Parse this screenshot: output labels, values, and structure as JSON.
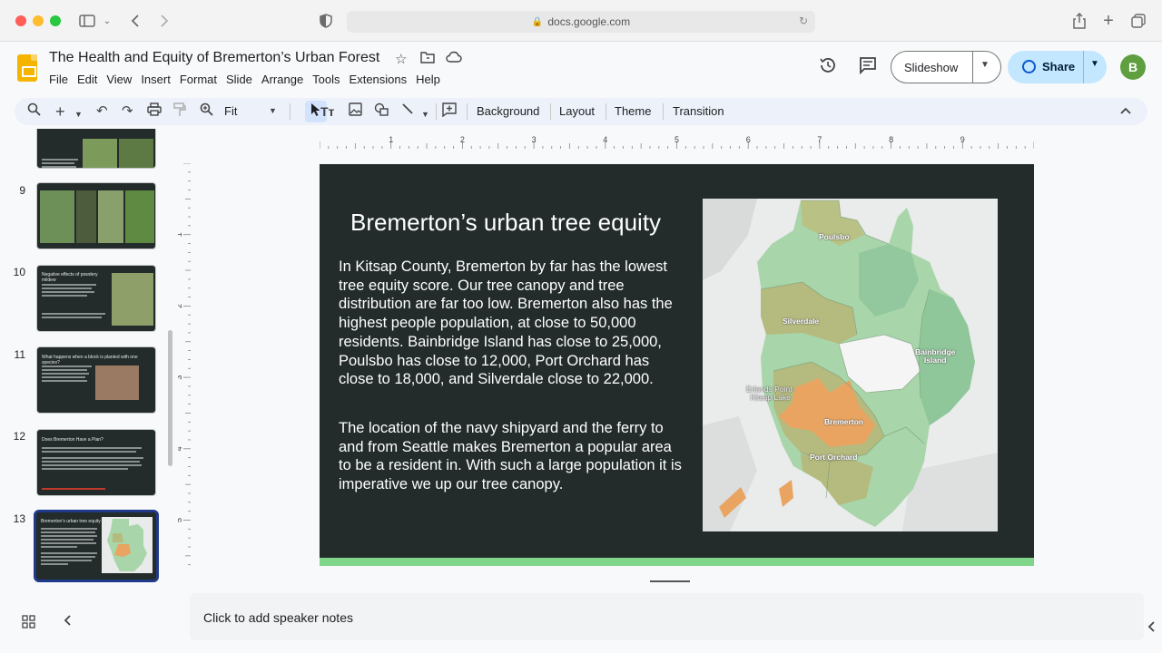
{
  "browser": {
    "url": "docs.google.com"
  },
  "app": {
    "doc_title": "The Health and Equity of Bremerton’s Urban Forest",
    "menu": [
      "File",
      "Edit",
      "View",
      "Insert",
      "Format",
      "Slide",
      "Arrange",
      "Tools",
      "Extensions",
      "Help"
    ],
    "slideshow_label": "Slideshow",
    "share_label": "Share",
    "avatar_initial": "B"
  },
  "toolbar": {
    "zoom": "Fit",
    "background_label": "Background",
    "layout_label": "Layout",
    "theme_label": "Theme",
    "transition_label": "Transition"
  },
  "filmstrip": {
    "numbers": [
      "9",
      "10",
      "11",
      "12",
      "13"
    ],
    "thumb_titles": {
      "t10": "Negative effects of powdery mildew",
      "t11": "What happens when a block is planted with one species?",
      "t12": "Does Bremerton Have a Plan?",
      "t13": "Bremerton’s urban tree equity"
    }
  },
  "ruler": {
    "top_labels": [
      "1",
      "2",
      "3",
      "4",
      "5",
      "6",
      "7",
      "8",
      "9"
    ],
    "left_labels": [
      "1",
      "2",
      "3",
      "4",
      "5"
    ]
  },
  "slide": {
    "title": "Bremerton’s urban tree equity",
    "paragraph1": "In Kitsap County, Bremerton by far has the lowest tree equity score. Our tree canopy and tree distribution are far too low. Bremerton also has the highest people population, at close to 50,000 residents. Bainbridge Island has close to 25,000, Poulsbo has close to 12,000, Port Orchard has close to 18,000, and Silverdale close to 22,000.",
    "paragraph2": "The location of the navy shipyard and the ferry to and from Seattle makes Bremerton a popular area to be a resident in. With such a large population it is imperative we up our tree canopy.",
    "map_labels": {
      "poulsbo": "Poulsbo",
      "silverdale": "Silverdale",
      "bainbridge": "Bainbridge\nIsland",
      "erlands": "Erlands Point-\nKitsap Lake",
      "bremerton": "Bremerton",
      "port_orchard": "Port Orchard"
    }
  },
  "notes": {
    "placeholder": "Click to add speaker notes"
  },
  "colors": {
    "slide_bg": "#232b2b",
    "accent_bar": "#7fd68a",
    "map_green_light": "#a8d5a9",
    "map_green": "#8fc79a",
    "map_olive": "#b5bb7e",
    "map_orange": "#e9a461"
  }
}
